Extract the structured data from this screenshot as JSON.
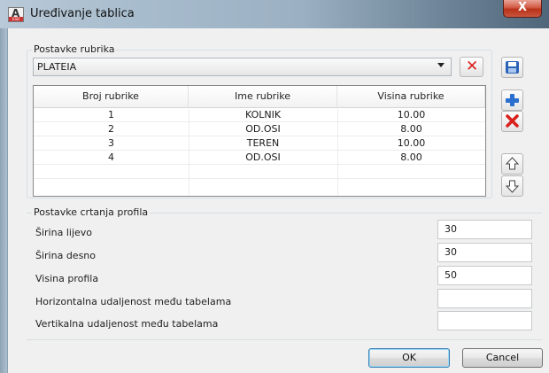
{
  "window": {
    "title": "Uređivanje tablica",
    "close_label": "X",
    "app_icon": "autocad-app-icon"
  },
  "section_rubrika": {
    "title": "Postavke rubrika",
    "combo_value": "PLATEIA",
    "grid_headers": [
      "Broj rubrike",
      "Ime rubrike",
      "Visina rubrike"
    ],
    "rows": [
      {
        "broj": "1",
        "ime": "KOLNIK",
        "visina": "10.00"
      },
      {
        "broj": "2",
        "ime": "OD.OSI",
        "visina": "8.00"
      },
      {
        "broj": "3",
        "ime": "TEREN",
        "visina": "10.00"
      },
      {
        "broj": "4",
        "ime": "OD.OSI",
        "visina": "8.00"
      }
    ]
  },
  "section_profil": {
    "title": "Postavke crtanja profila",
    "fields": [
      {
        "label": "Širina lijevo",
        "value": "30"
      },
      {
        "label": "Širina desno",
        "value": "30"
      },
      {
        "label": "Visina profila",
        "value": "50"
      },
      {
        "label": "Horizontalna udaljenost među tabelama",
        "value": ""
      },
      {
        "label": "Vertikalna udaljenost među tabelama",
        "value": ""
      }
    ]
  },
  "buttons": {
    "ok": "OK",
    "cancel": "Cancel"
  },
  "colors": {
    "delete_red": "#d8211c",
    "save_blue": "#2b63b8",
    "add_blue": "#2a6fcf"
  }
}
